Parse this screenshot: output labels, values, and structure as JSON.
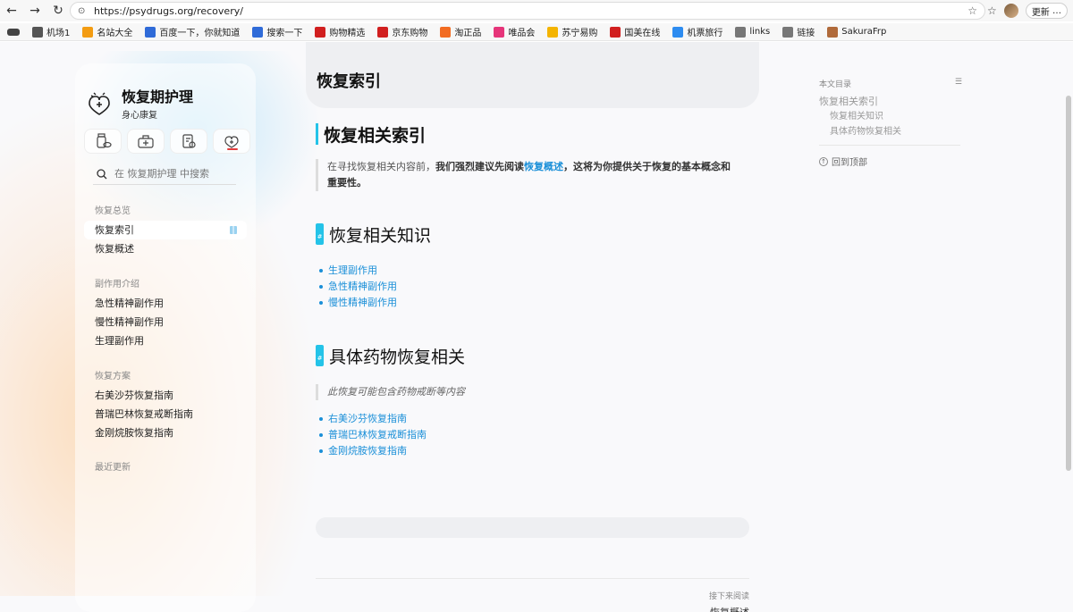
{
  "browser": {
    "url": "https://psydrugs.org/recovery/",
    "update_label": "更新",
    "bookmarks": [
      "机场1",
      "名站大全",
      "百度一下，你就知道",
      "搜索一下",
      "购物精选",
      "京东购物",
      "淘正品",
      "唯品会",
      "苏宁易购",
      "国美在线",
      "机票旅行",
      "links",
      "链接",
      "SakuraFrp"
    ],
    "bookmark_colors": [
      "#555555",
      "#f39c12",
      "#2f6bd8",
      "#2f6bd8",
      "#d11f1f",
      "#d11f1f",
      "#f26c22",
      "#e6357a",
      "#f4b400",
      "#d11f1f",
      "#2d8cf0",
      "#777777",
      "#777777",
      "#b06a3a"
    ]
  },
  "sidebar": {
    "brand_title": "恢复期护理",
    "brand_sub": "身心康复",
    "search_placeholder": "在 恢复期护理 中搜索",
    "sections": [
      {
        "heading": "恢复总览",
        "items": [
          "恢复索引",
          "恢复概述"
        ]
      },
      {
        "heading": "副作用介绍",
        "items": [
          "急性精神副作用",
          "慢性精神副作用",
          "生理副作用"
        ]
      },
      {
        "heading": "恢复方案",
        "items": [
          "右美沙芬恢复指南",
          "普瑞巴林恢复戒断指南",
          "金刚烷胺恢复指南"
        ]
      },
      {
        "heading": "最近更新",
        "items": []
      }
    ],
    "active_item": "恢复索引"
  },
  "main": {
    "hero_title": "恢复索引",
    "h1": "恢复相关索引",
    "intro_plain": "在寻找恢复相关内容前，",
    "intro_bold1": "我们强烈建议先阅读",
    "intro_link": "恢复概述",
    "intro_bold2": "，这将为你提供关于恢复的基本概念和重要性。",
    "section1_title": "恢复相关知识",
    "section1_links": [
      "生理副作用",
      "急性精神副作用",
      "慢性精神副作用"
    ],
    "section2_title": "具体药物恢复相关",
    "section2_note": "此恢复可能包含药物戒断等内容",
    "section2_links": [
      "右美沙芬恢复指南",
      "普瑞巴林恢复戒断指南",
      "金刚烷胺恢复指南"
    ],
    "next_label": "接下来阅读",
    "next_title": "恢复概述"
  },
  "toc": {
    "heading": "本文目录",
    "items": [
      {
        "label": "恢复相关索引",
        "level": 1
      },
      {
        "label": "恢复相关知识",
        "level": 2
      },
      {
        "label": "具体药物恢复相关",
        "level": 2
      }
    ],
    "back_to_top": "回到顶部"
  },
  "colors": {
    "accent": "#24c3e8",
    "link": "#1a8fd8",
    "active_marker": "#e23a3a"
  }
}
